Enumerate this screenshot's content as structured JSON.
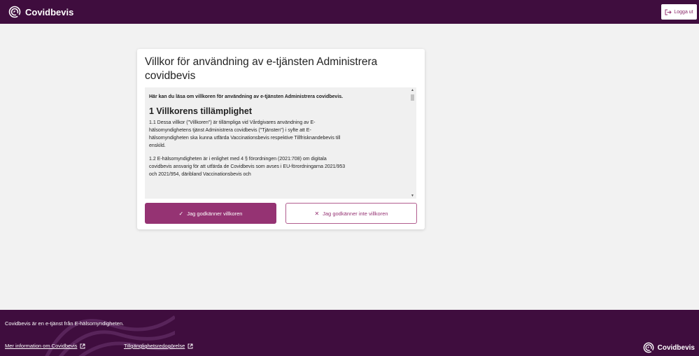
{
  "header": {
    "brand": "Covidbevis",
    "logout_label": "Logga ut",
    "brand_icon": "covidbevis-logo-icon",
    "logout_icon": "logout-icon"
  },
  "card": {
    "title": "Villkor för användning av e-tjänsten Administrera covidbevis",
    "intro": "Här kan du läsa om villkoren för användning av e-tjänsten Administrera covidbevis.",
    "section_heading": "1 Villkorens tillämplighet",
    "paragraph_1": "1.1 Dessa villkor (\"Villkoren\") är tillämpliga vid Vårdgivares användning av E-hälsomyndighetens tjänst Administrera covidbevis (\"Tjänsten\") i syfte att E-hälsomyndigheten ska kunna utfärda Vaccinationsbevis respektive Tillfrisknandebevis till enskild.",
    "paragraph_2": "1.2 E-hälsomyndigheten är i enlighet med 4 § förordningen (2021:708) om digitala covidbevis ansvarig för att utfärda de Covidbevis som avses i EU-förordningarna 2021/953 och 2021/954, däribland Vaccinationsbevis och",
    "accept_label": "Jag godkänner villkoren",
    "decline_label": "Jag godkänner inte villkoren"
  },
  "footer": {
    "text": "Covidbevis är en e-tjänst från E-hälsomyndigheten.",
    "link_more": "Mer information om Covidbevis",
    "link_accessibility": "Tillgänglighetsredogörelse",
    "brand": "Covidbevis"
  },
  "colors": {
    "header_bg": "#3f0d3e",
    "accent": "#953373",
    "page_bg": "#f2f2f2"
  }
}
